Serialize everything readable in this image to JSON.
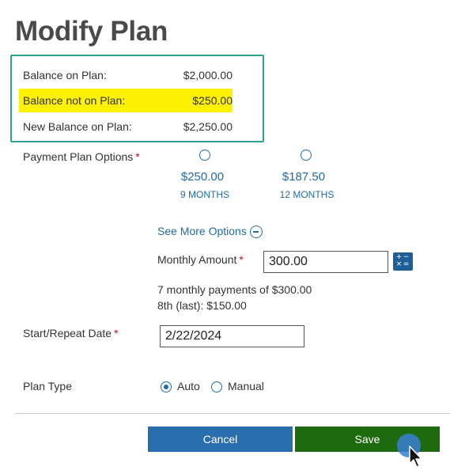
{
  "page": {
    "title": "Modify Plan"
  },
  "balance": {
    "on_plan_label": "Balance on Plan:",
    "on_plan_value": "$2,000.00",
    "not_on_plan_label": "Balance not on Plan:",
    "not_on_plan_value": "$250.00",
    "new_balance_label": "New Balance on Plan:",
    "new_balance_value": "$2,250.00"
  },
  "payment_options": {
    "label": "Payment Plan Options",
    "required": "*",
    "options": [
      {
        "amount": "$250.00",
        "term": "9 MONTHS"
      },
      {
        "amount": "$187.50",
        "term": "12 MONTHS"
      }
    ]
  },
  "see_more": {
    "label": "See More Options"
  },
  "monthly": {
    "label": "Monthly Amount",
    "required": "*",
    "value": "300.00",
    "summary_line1": "7 monthly payments of $300.00",
    "summary_line2": "8th (last): $150.00"
  },
  "start_date": {
    "label": "Start/Repeat Date",
    "required": "*",
    "value": "2/22/2024"
  },
  "plan_type": {
    "label": "Plan Type",
    "auto": "Auto",
    "manual": "Manual",
    "selected": "Auto"
  },
  "buttons": {
    "cancel": "Cancel",
    "save": "Save"
  },
  "colors": {
    "accent": "#1f6ca8",
    "highlight": "#fff200",
    "border": "#2aa396",
    "save": "#1e6a0e",
    "cancel": "#2a6fad"
  },
  "icons": {
    "collapse": "minus-circle-icon",
    "calculator": "calculator-icon"
  }
}
